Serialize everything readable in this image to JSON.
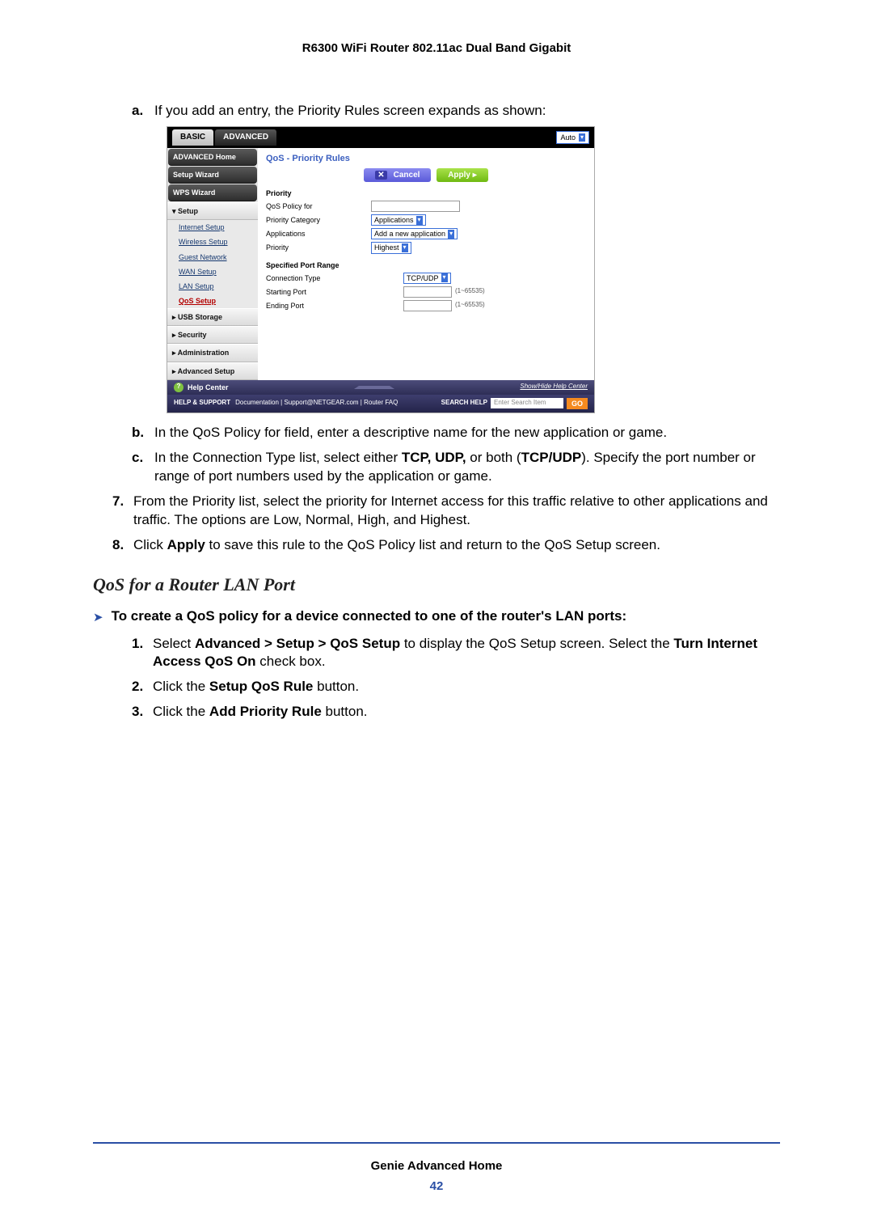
{
  "header": "R6300 WiFi Router 802.11ac Dual Band Gigabit",
  "steps": {
    "a_marker": "a.",
    "a_text": "If you add an entry, the Priority Rules screen expands as shown:",
    "b_marker": "b.",
    "b_text": "In the QoS Policy for field, enter a descriptive name for the new application or game.",
    "c_marker": "c.",
    "c_pre": "In the Connection Type list, select either ",
    "c_b1": "TCP, UDP,",
    "c_mid": " or both (",
    "c_b2": "TCP/UDP",
    "c_post": "). Specify the port number or range of port numbers used by the application or game.",
    "s7_marker": "7.",
    "s7_text": "From the Priority list, select the priority for Internet access for this traffic relative to other applications and traffic. The options are Low, Normal, High, and Highest.",
    "s8_marker": "8.",
    "s8_pre": "Click ",
    "s8_b": "Apply",
    "s8_post": " to save this rule to the QoS Policy list and return to the QoS Setup screen."
  },
  "section_heading": "QoS for a Router LAN Port",
  "proc_intro": "To create a QoS policy for a device connected to one of the router's LAN ports:",
  "proc": {
    "p1_marker": "1.",
    "p1_pre": "Select ",
    "p1_b1": "Advanced > Setup > QoS Setup",
    "p1_mid": " to display the QoS Setup screen. Select the ",
    "p1_b2": "Turn Internet Access QoS On",
    "p1_post": " check box.",
    "p2_marker": "2.",
    "p2_pre": "Click the ",
    "p2_b": "Setup QoS Rule",
    "p2_post": " button.",
    "p3_marker": "3.",
    "p3_pre": "Click the ",
    "p3_b": "Add Priority Rule",
    "p3_post": " button."
  },
  "shot": {
    "tabs": {
      "basic": "BASIC",
      "advanced": "ADVANCED"
    },
    "auto": "Auto",
    "nav": {
      "adv_home": "ADVANCED Home",
      "setup_wizard": "Setup Wizard",
      "wps_wizard": "WPS Wizard",
      "setup": "▾ Setup",
      "internet": "Internet Setup",
      "wireless": "Wireless Setup",
      "guest": "Guest Network",
      "wan": "WAN Setup",
      "lan": "LAN Setup",
      "qos": "QoS Setup",
      "usb": "▸ USB Storage",
      "security": "▸ Security",
      "admin": "▸ Administration",
      "advsetup": "▸ Advanced Setup"
    },
    "panel_title": "QoS - Priority Rules",
    "btn_cancel": "Cancel",
    "btn_apply": "Apply",
    "labels": {
      "priority_hdr": "Priority",
      "policy_for": "QoS Policy for",
      "category": "Priority Category",
      "applications": "Applications",
      "priority": "Priority",
      "port_range": "Specified Port Range",
      "conn_type": "Connection Type",
      "start_port": "Starting Port",
      "end_port": "Ending Port"
    },
    "selects": {
      "category": "Applications",
      "applications": "Add a new application",
      "priority": "Highest",
      "conn_type": "TCP/UDP"
    },
    "hints": {
      "range": "(1~65535)"
    },
    "helpcenter": "Help Center",
    "showhide": "Show/Hide Help Center",
    "support": {
      "label": "HELP & SUPPORT",
      "links": "Documentation | Support@NETGEAR.com | Router FAQ",
      "search_label": "SEARCH HELP",
      "placeholder": "Enter Search Item",
      "go": "GO"
    }
  },
  "footer": {
    "title": "Genie Advanced Home",
    "page": "42"
  }
}
